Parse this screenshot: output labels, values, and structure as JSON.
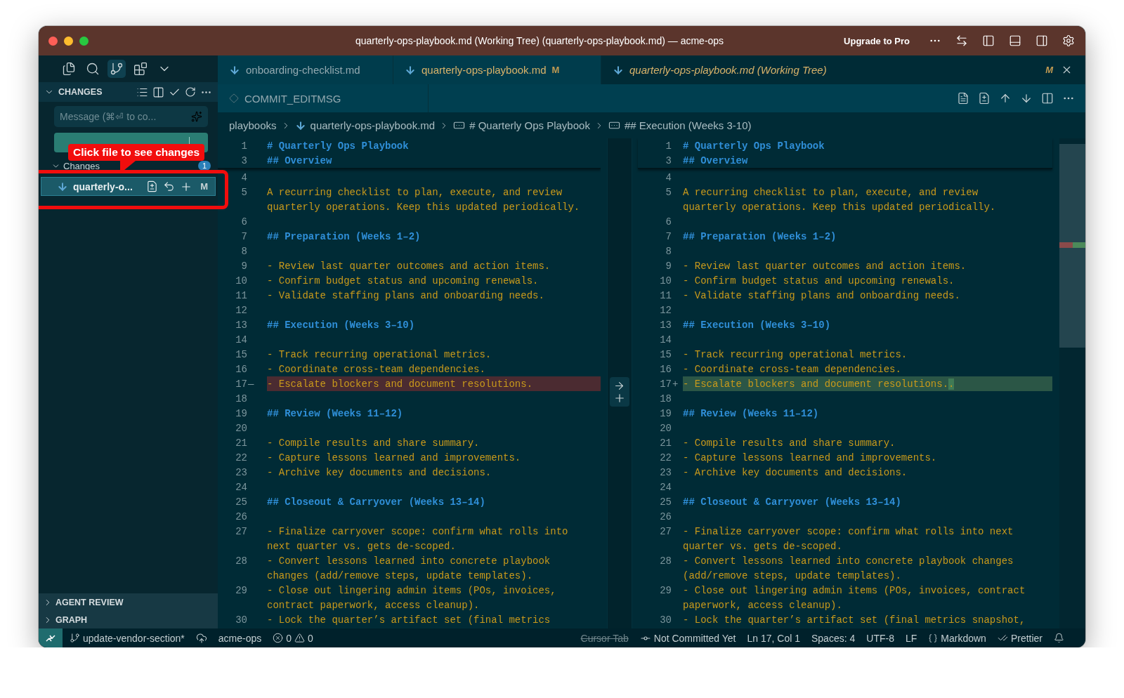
{
  "window": {
    "title": "quarterly-ops-playbook.md (Working Tree) (quarterly-ops-playbook.md) — acme-ops",
    "upgrade_label": "Upgrade to Pro"
  },
  "activity_bar": [
    {
      "kind": "files",
      "selected": false
    },
    {
      "kind": "search",
      "selected": false
    },
    {
      "kind": "source-control",
      "selected": true
    },
    {
      "kind": "extensions",
      "selected": false
    },
    {
      "kind": "more",
      "selected": false
    }
  ],
  "changes_panel": {
    "title": "CHANGES",
    "message_field": {
      "placeholder": "Message (⌘⏎ to co..."
    },
    "group": {
      "label": "Changes",
      "count": "1"
    },
    "files": [
      {
        "name": "quarterly-o...",
        "status": "M",
        "selected": true
      }
    ]
  },
  "collapsed_sections": [
    "AGENT REVIEW",
    "GRAPH"
  ],
  "callout": {
    "text": "Click file to see changes"
  },
  "tabs": [
    {
      "label": "onboarding-checklist.md",
      "modified": false,
      "preview": false,
      "selected": false
    },
    {
      "label": "quarterly-ops-playbook.md",
      "status": "M",
      "modified": true,
      "preview": false,
      "selected": false
    },
    {
      "label": "quarterly-ops-playbook.md (Working Tree)",
      "status": "M",
      "modified": true,
      "preview": true,
      "selected": true
    }
  ],
  "secondary_tab": {
    "label": "COMMIT_EDITMSG"
  },
  "breadcrumbs": [
    {
      "kind": "folder",
      "label": "playbooks"
    },
    {
      "kind": "file",
      "label": "quarterly-ops-playbook.md"
    },
    {
      "kind": "symbol",
      "label": "# Quarterly Ops Playbook"
    },
    {
      "kind": "symbol",
      "label": "## Execution (Weeks 3-10)"
    }
  ],
  "diff": {
    "original": {
      "sticky": [
        {
          "number": "1",
          "kind": "heading",
          "lines": [
            "# Quarterly Ops Playbook"
          ]
        },
        {
          "number": "3",
          "kind": "heading",
          "lines": [
            "## Overview"
          ]
        }
      ],
      "rows": [
        {
          "number": "4",
          "kind": "blank"
        },
        {
          "number": "5",
          "kind": "text",
          "lines": [
            "A recurring checklist to plan, execute, and review",
            "quarterly operations. Keep this updated periodically."
          ]
        },
        {
          "number": "6",
          "kind": "blank"
        },
        {
          "number": "7",
          "kind": "heading",
          "lines": [
            "## Preparation (Weeks 1–2)"
          ]
        },
        {
          "number": "8",
          "kind": "blank"
        },
        {
          "number": "9",
          "kind": "text",
          "lines": [
            "- Review last quarter outcomes and action items."
          ]
        },
        {
          "number": "10",
          "kind": "text",
          "lines": [
            "- Confirm budget status and upcoming renewals."
          ]
        },
        {
          "number": "11",
          "kind": "text",
          "lines": [
            "- Validate staffing plans and onboarding needs."
          ]
        },
        {
          "number": "12",
          "kind": "blank"
        },
        {
          "number": "13",
          "kind": "heading",
          "lines": [
            "## Execution (Weeks 3–10)"
          ]
        },
        {
          "number": "14",
          "kind": "blank"
        },
        {
          "number": "15",
          "kind": "text",
          "lines": [
            "- Track recurring operational metrics."
          ]
        },
        {
          "number": "16",
          "kind": "text",
          "lines": [
            "- Coordinate cross-team dependencies."
          ]
        },
        {
          "number": "17",
          "kind": "removed",
          "marker": "—",
          "lines": [
            "- Escalate blockers and document resolutions."
          ]
        },
        {
          "number": "18",
          "kind": "blank"
        },
        {
          "number": "19",
          "kind": "heading",
          "lines": [
            "## Review (Weeks 11–12)"
          ]
        },
        {
          "number": "20",
          "kind": "blank"
        },
        {
          "number": "21",
          "kind": "text",
          "lines": [
            "- Compile results and share summary."
          ]
        },
        {
          "number": "22",
          "kind": "text",
          "lines": [
            "- Capture lessons learned and improvements."
          ]
        },
        {
          "number": "23",
          "kind": "text",
          "lines": [
            "- Archive key documents and decisions."
          ]
        },
        {
          "number": "24",
          "kind": "blank"
        },
        {
          "number": "25",
          "kind": "heading",
          "lines": [
            "## Closeout & Carryover (Weeks 13–14)"
          ]
        },
        {
          "number": "26",
          "kind": "blank"
        },
        {
          "number": "27",
          "kind": "text",
          "lines": [
            "- Finalize carryover scope: confirm what rolls into",
            "next quarter vs. gets de-scoped."
          ]
        },
        {
          "number": "28",
          "kind": "text",
          "lines": [
            "- Convert lessons learned into concrete playbook",
            "changes (add/remove steps, update templates)."
          ]
        },
        {
          "number": "29",
          "kind": "text",
          "lines": [
            "- Close out lingering admin items (POs, invoices,",
            "contract paperwork, access cleanup)."
          ]
        },
        {
          "number": "30",
          "kind": "text",
          "lines": [
            "- Lock the quarter’s artifact set (final metrics"
          ]
        }
      ]
    },
    "modified": {
      "sticky": [
        {
          "number": "1",
          "kind": "heading",
          "lines": [
            "# Quarterly Ops Playbook"
          ]
        },
        {
          "number": "3",
          "kind": "heading",
          "lines": [
            "## Overview"
          ]
        }
      ],
      "rows": [
        {
          "number": "4",
          "kind": "blank"
        },
        {
          "number": "5",
          "kind": "text",
          "lines": [
            "A recurring checklist to plan, execute, and review",
            "quarterly operations. Keep this updated periodically."
          ]
        },
        {
          "number": "6",
          "kind": "blank"
        },
        {
          "number": "7",
          "kind": "heading",
          "lines": [
            "## Preparation (Weeks 1–2)"
          ]
        },
        {
          "number": "8",
          "kind": "blank"
        },
        {
          "number": "9",
          "kind": "text",
          "lines": [
            "- Review last quarter outcomes and action items."
          ]
        },
        {
          "number": "10",
          "kind": "text",
          "lines": [
            "- Confirm budget status and upcoming renewals."
          ]
        },
        {
          "number": "11",
          "kind": "text",
          "lines": [
            "- Validate staffing plans and onboarding needs."
          ]
        },
        {
          "number": "12",
          "kind": "blank"
        },
        {
          "number": "13",
          "kind": "heading",
          "lines": [
            "## Execution (Weeks 3–10)"
          ]
        },
        {
          "number": "14",
          "kind": "blank"
        },
        {
          "number": "15",
          "kind": "text",
          "lines": [
            "- Track recurring operational metrics."
          ]
        },
        {
          "number": "16",
          "kind": "text",
          "lines": [
            "- Coordinate cross-team dependencies."
          ]
        },
        {
          "number": "17",
          "kind": "added",
          "marker": "+",
          "lines": [
            "- Escalate blockers and document resolutions."
          ],
          "inserted": "."
        },
        {
          "number": "18",
          "kind": "blank"
        },
        {
          "number": "19",
          "kind": "heading",
          "lines": [
            "## Review (Weeks 11–12)"
          ]
        },
        {
          "number": "20",
          "kind": "blank"
        },
        {
          "number": "21",
          "kind": "text",
          "lines": [
            "- Compile results and share summary."
          ]
        },
        {
          "number": "22",
          "kind": "text",
          "lines": [
            "- Capture lessons learned and improvements."
          ]
        },
        {
          "number": "23",
          "kind": "text",
          "lines": [
            "- Archive key documents and decisions."
          ]
        },
        {
          "number": "24",
          "kind": "blank"
        },
        {
          "number": "25",
          "kind": "heading",
          "lines": [
            "## Closeout & Carryover (Weeks 13–14)"
          ]
        },
        {
          "number": "26",
          "kind": "blank"
        },
        {
          "number": "27",
          "kind": "text",
          "lines": [
            "- Finalize carryover scope: confirm what rolls into next",
            "quarter vs. gets de-scoped."
          ]
        },
        {
          "number": "28",
          "kind": "text",
          "lines": [
            "- Convert lessons learned into concrete playbook changes",
            "(add/remove steps, update templates)."
          ]
        },
        {
          "number": "29",
          "kind": "text",
          "lines": [
            "- Close out lingering admin items (POs, invoices, contract",
            "paperwork, access cleanup)."
          ]
        },
        {
          "number": "30",
          "kind": "text",
          "lines": [
            "- Lock the quarter’s artifact set (final metrics snapshot,"
          ]
        }
      ]
    }
  },
  "status_bar": {
    "left": [
      {
        "kind": "remote"
      },
      {
        "kind": "branch",
        "text": "update-vendor-section*"
      },
      {
        "kind": "publish"
      },
      {
        "kind": "plain",
        "text": "acme-ops"
      },
      {
        "kind": "problems",
        "errors": "0",
        "warnings": "0"
      }
    ],
    "right": [
      {
        "kind": "disabled",
        "text": "Cursor Tab"
      },
      {
        "kind": "commit",
        "text": "Not Committed Yet"
      },
      {
        "kind": "plain",
        "text": "Ln 17, Col 1"
      },
      {
        "kind": "plain",
        "text": "Spaces: 4"
      },
      {
        "kind": "plain",
        "text": "UTF-8"
      },
      {
        "kind": "plain",
        "text": "LF"
      },
      {
        "kind": "language",
        "text": "Markdown"
      },
      {
        "kind": "formatter",
        "text": "Prettier"
      },
      {
        "kind": "notifications"
      }
    ]
  }
}
